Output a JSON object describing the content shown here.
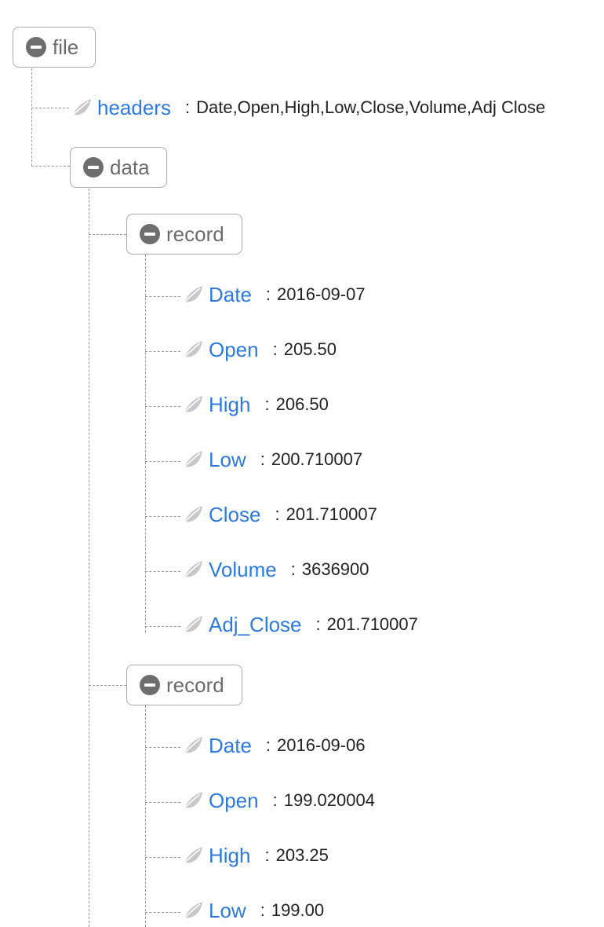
{
  "root": {
    "label": "file",
    "icon": "collapse-icon",
    "headers": {
      "key": "headers",
      "value": "Date,Open,High,Low,Close,Volume,Adj Close",
      "icon": "leaf-icon"
    },
    "data": {
      "label": "data",
      "icon": "collapse-icon",
      "records": [
        {
          "label": "record",
          "fields": [
            {
              "key": "Date",
              "value": "2016-09-07"
            },
            {
              "key": "Open",
              "value": "205.50"
            },
            {
              "key": "High",
              "value": "206.50"
            },
            {
              "key": "Low",
              "value": "200.710007"
            },
            {
              "key": "Close",
              "value": "201.710007"
            },
            {
              "key": "Volume",
              "value": "3636900"
            },
            {
              "key": "Adj_Close",
              "value": "201.710007"
            }
          ]
        },
        {
          "label": "record",
          "fields": [
            {
              "key": "Date",
              "value": "2016-09-06"
            },
            {
              "key": "Open",
              "value": "199.020004"
            },
            {
              "key": "High",
              "value": "203.25"
            },
            {
              "key": "Low",
              "value": "199.00"
            }
          ]
        }
      ]
    }
  },
  "colors": {
    "key": "#2f79d9",
    "node_text": "#6b6b6b",
    "value_text": "#222222",
    "connector": "#9a9a9a",
    "leaf_icon": "#c8c8c8"
  }
}
